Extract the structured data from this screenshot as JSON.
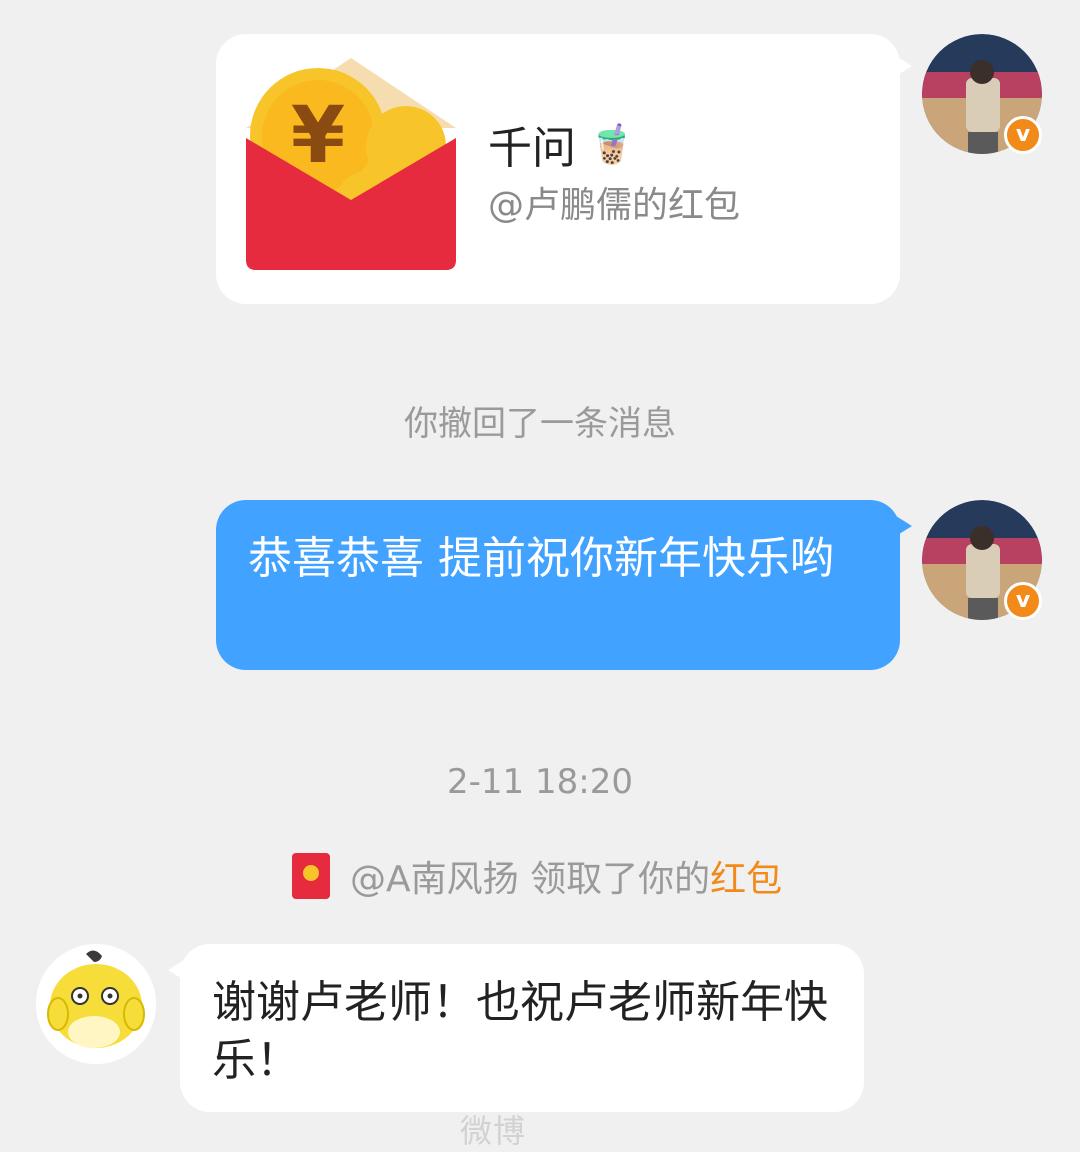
{
  "red_packet": {
    "title": "千问",
    "title_emoji": "🧋",
    "subtitle": "@卢鹏儒的红包",
    "icon_symbol": "¥",
    "colors": {
      "red": "#e52b3d",
      "gold": "#f7c52a"
    }
  },
  "self_avatar": {
    "badge": "v",
    "badge_color": "#f28a1a"
  },
  "system": {
    "recall_message": "你撤回了一条消息",
    "timestamp": "2-11 18:20"
  },
  "messages": [
    {
      "from": "self",
      "text": "恭喜恭喜 提前祝你新年快乐哟",
      "bubble_color": "#42a2ff"
    },
    {
      "from": "other",
      "text": "谢谢卢老师！也祝卢老师新年快乐！",
      "bubble_color": "#ffffff"
    }
  ],
  "claimed_notice": {
    "prefix": "@A南风扬 领取了你的",
    "link": "红包",
    "link_color": "#f28a1a"
  },
  "watermark": "微博"
}
